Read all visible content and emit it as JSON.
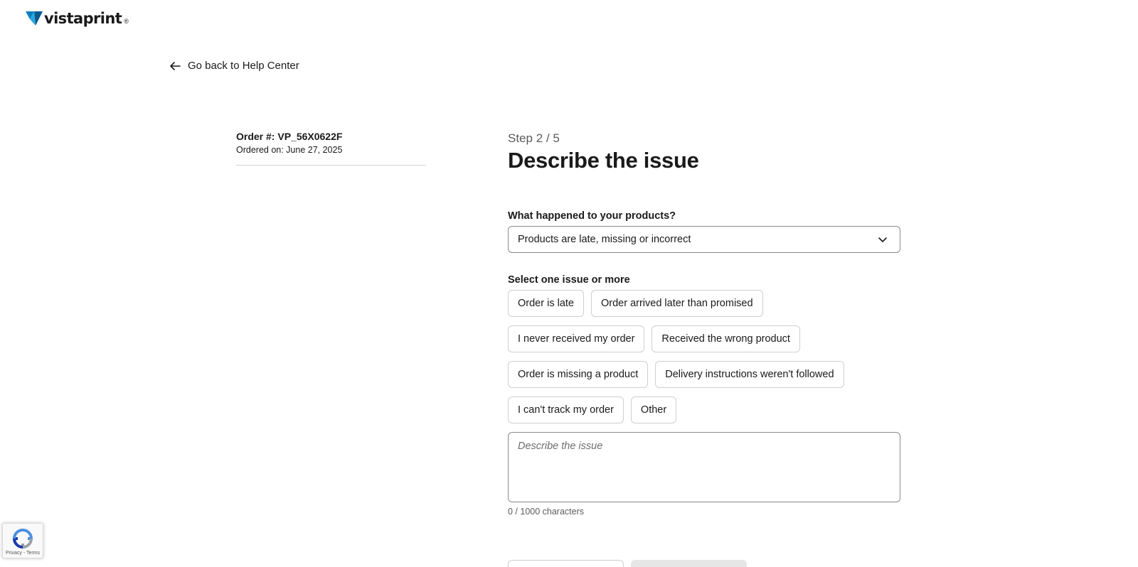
{
  "brand": {
    "logo_text": "vistaprint",
    "logo_reg": "®",
    "accent": "#0b7fbe"
  },
  "back_link": {
    "label": "Go back to Help Center",
    "icon": "arrow-left-icon"
  },
  "order": {
    "number": "Order #: VP_56X0622F",
    "date": "Ordered on: June 27, 2025"
  },
  "form": {
    "step": "Step 2 / 5",
    "title": "Describe the issue",
    "products_label": "What happened to your products?",
    "products_selected": "Products are late, missing or incorrect",
    "issues_label": "Select one issue or more",
    "issues": [
      "Order is late",
      "Order arrived later than promised",
      "I never received my order",
      "Received the wrong product",
      "Order is missing a product",
      "Delivery instructions weren't followed",
      "I can't track my order",
      "Other"
    ],
    "description_placeholder": "Describe the issue",
    "char_count": "0 / 1000 characters"
  },
  "recaptcha": {
    "links": "Privacy - Terms",
    "icon": "recaptcha-icon"
  }
}
